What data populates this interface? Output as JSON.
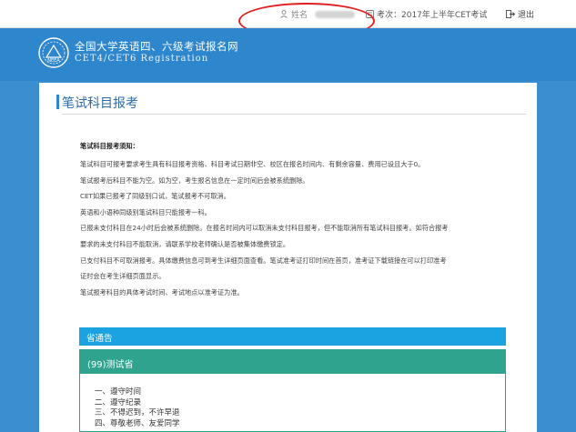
{
  "topbar": {
    "user_label": "姓名",
    "exam_label": "考次：2017年上半年CET考试",
    "logout_label": "退出"
  },
  "banner": {
    "title_cn": "全国大学英语四、六级考试报名网",
    "title_en": "CET4/CET6  Registration"
  },
  "page": {
    "title": "笔试科目报考"
  },
  "notice": {
    "heading": "笔试科目报考须知：",
    "lines": [
      "笔试科目可报考要求考生具有科目报考资格、科目考试日期非空、校区在报名时间内、有剩余容量、费用已设且大于0。",
      "笔试报考后科目不能为空。如为空，考生报名信息在一定时间后会被系统删除。",
      "CET如果已报考了同级别口试，笔试报考不可取消。",
      "英语和小语种同级别笔试科目只能报考一科。",
      "已报未支付科目在24小时后会被系统删除。在报名时间内可以取消未支付科目报考，但不能取消所有笔试科目报考。如符合报考",
      "要求的未支付科目不能取消，请联系学校老师确认是否被集体缴费锁定。",
      "已支付科目不可取消报考。具体缴费信息可到考生详细页面查看。笔试准考证打印时间在首页，准考证下载链接在可以打印准考",
      "证时会在考生详细页面显示。",
      "笔试报考科目的具体考试时间、考试地点以准考证为准。"
    ]
  },
  "announcement": {
    "label": "省通告"
  },
  "province": {
    "header": "(99)测试省",
    "rules": [
      "一、遵守时间",
      "二、遵守纪录",
      "三、不得迟到，不许早退",
      "四、尊敬老师、友爱同学"
    ]
  },
  "colors": {
    "banner": "#2e86cc",
    "announcement_bar": "#1aa3e0",
    "province_header": "#2fa38d",
    "annotation_oval": "#e02020"
  }
}
